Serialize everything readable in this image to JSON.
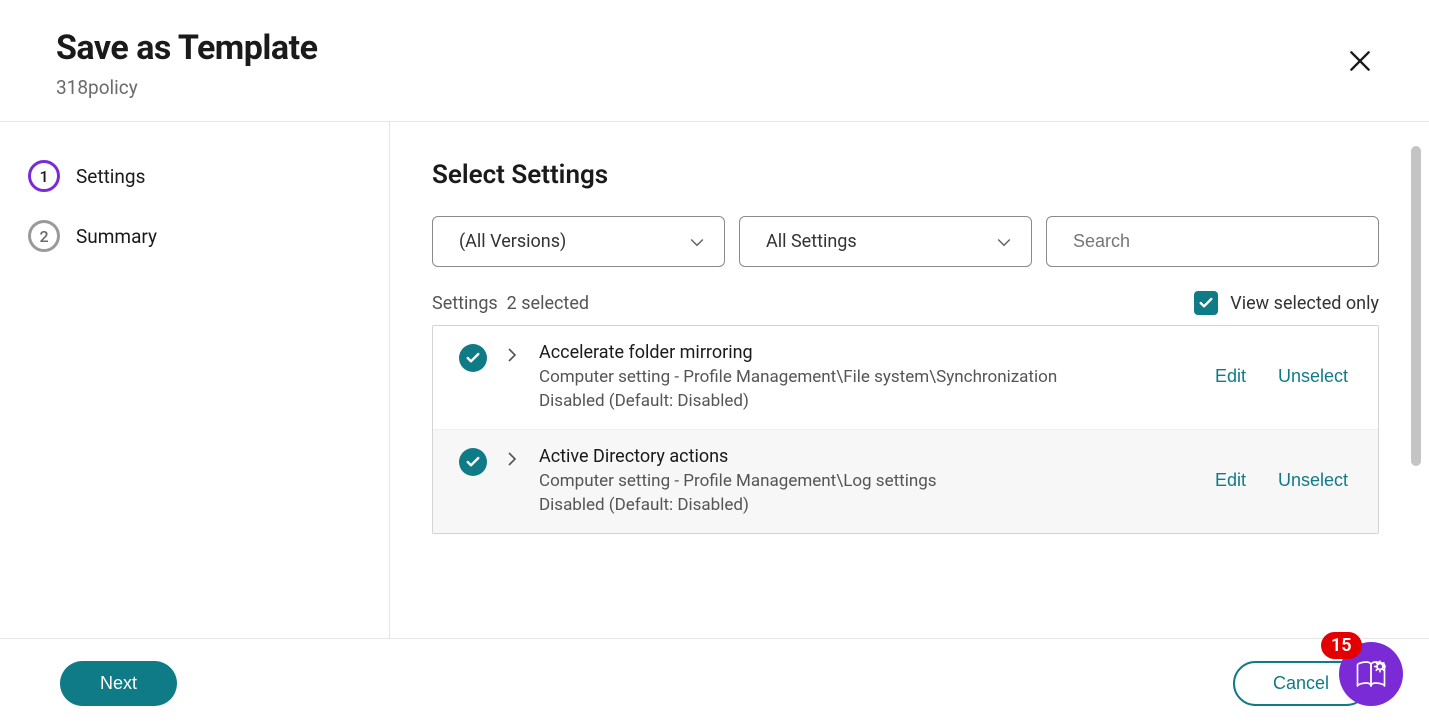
{
  "header": {
    "title": "Save as Template",
    "subtitle": "318policy"
  },
  "steps": [
    {
      "num": "1",
      "label": "Settings",
      "active": true
    },
    {
      "num": "2",
      "label": "Summary",
      "active": false
    }
  ],
  "main": {
    "section_title": "Select Settings",
    "filters": {
      "versions": "(All Versions)",
      "category": "All Settings",
      "search_placeholder": "Search"
    },
    "count": {
      "label": "Settings",
      "selected": "2 selected"
    },
    "view_selected_only": {
      "label": "View selected only",
      "checked": true
    },
    "actions": {
      "edit": "Edit",
      "unselect": "Unselect"
    },
    "settings": [
      {
        "title": "Accelerate folder mirroring",
        "path": "Computer setting - Profile Management\\File system\\Synchronization",
        "value": "Disabled (Default: Disabled)"
      },
      {
        "title": "Active Directory actions",
        "path": "Computer setting - Profile Management\\Log settings",
        "value": "Disabled (Default: Disabled)"
      }
    ]
  },
  "footer": {
    "next": "Next",
    "cancel": "Cancel"
  },
  "help_badge": "15"
}
